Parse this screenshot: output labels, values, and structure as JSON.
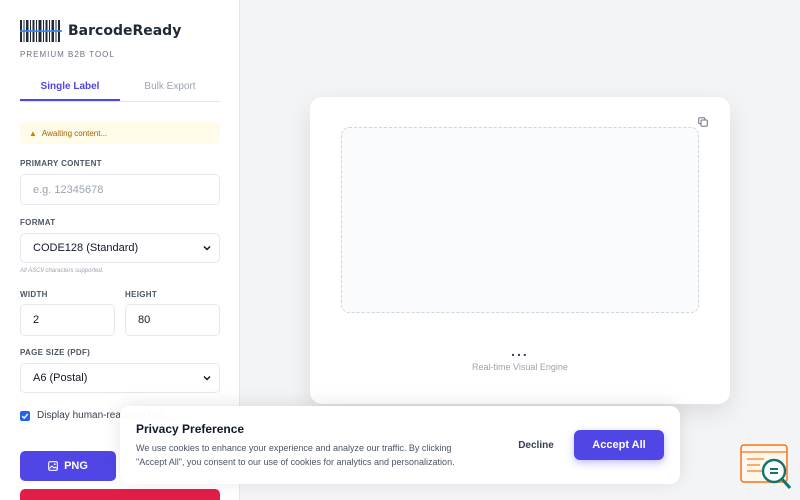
{
  "brand": {
    "name": "BarcodeReady",
    "subtitle": "PREMIUM B2B TOOL"
  },
  "tabs": [
    {
      "label": "Single Label",
      "active": true
    },
    {
      "label": "Bulk Export",
      "active": false
    }
  ],
  "alert": {
    "icon": "warning-icon",
    "text": "Awaiting content..."
  },
  "form": {
    "primary_content": {
      "label": "PRIMARY CONTENT",
      "value": "",
      "placeholder": "e.g. 12345678"
    },
    "format": {
      "label": "FORMAT",
      "selected": "CODE128 (Standard)",
      "hint": "All ASCII characters supported."
    },
    "width": {
      "label": "WIDTH",
      "value": "2"
    },
    "height": {
      "label": "HEIGHT",
      "value": "80"
    },
    "page_size": {
      "label": "PAGE SIZE (PDF)",
      "selected": "A6 (Postal)"
    },
    "human_readable": {
      "label": "Display human-readable text",
      "checked": true
    }
  },
  "actions": {
    "png_label": "PNG",
    "pdf_label": ""
  },
  "preview": {
    "dots": "...",
    "engine_label": "Real-time Visual Engine"
  },
  "cookie": {
    "title": "Privacy Preference",
    "text": "We use cookies to enhance your experience and analyze our traffic. By clicking \"Accept All\", you consent to our use of cookies for analytics and personalization.",
    "decline_label": "Decline",
    "accept_label": "Accept All"
  },
  "colors": {
    "accent": "#4f46e5",
    "danger": "#e11d48",
    "checkbox": "#2563eb",
    "alert_bg": "#fefce8",
    "alert_text": "#a16207"
  }
}
